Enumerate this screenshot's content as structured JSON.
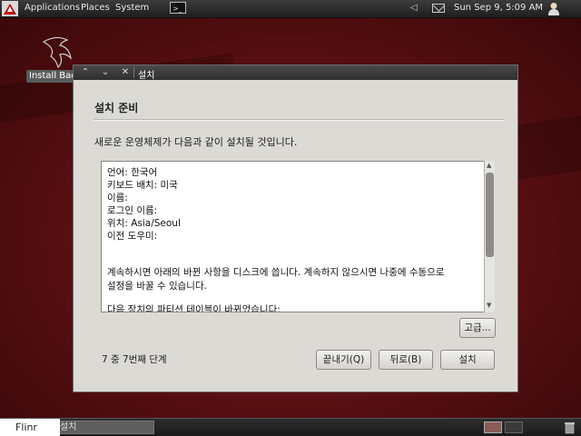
{
  "top_panel": {
    "menus": [
      "Applications",
      "Places",
      "System"
    ],
    "terminal_glyph": ">_",
    "clock": "Sun Sep  9,  5:09 AM",
    "icons": [
      "kali-dragon-icon",
      "terminal-icon",
      "volume-icon",
      "mail-icon",
      "user-icon"
    ]
  },
  "desktop": {
    "icon_label": "Install Backtrack"
  },
  "window": {
    "title": "설치",
    "heading": "설치 준비",
    "description": "새로운 운영체제가 다음과 같이 설치될 것입니다.",
    "summary_lines": [
      "언어: 한국어",
      "키보드 배치: 미국",
      "이름:",
      "로그인 이름:",
      "위치: Asia/Seoul",
      "이전 도우미:",
      "",
      "",
      "계속하시면 아래의 바뀐 사항을 디스크에 씁니다. 계속하지 않으시면 나중에 수동으로",
      "설정을 바꿀 수 있습니다.",
      "",
      "다음 장치의 파티션 테이블이 바뀌었습니다:"
    ],
    "advanced_button": "고급...",
    "step_text": "7 중 7번째 단계",
    "quit_button": "끝내기(Q)",
    "back_button": "뒤로(B)",
    "install_button": "설치"
  },
  "bottom_panel": {
    "show_desktop": "Flinr",
    "task_label": "설치"
  }
}
